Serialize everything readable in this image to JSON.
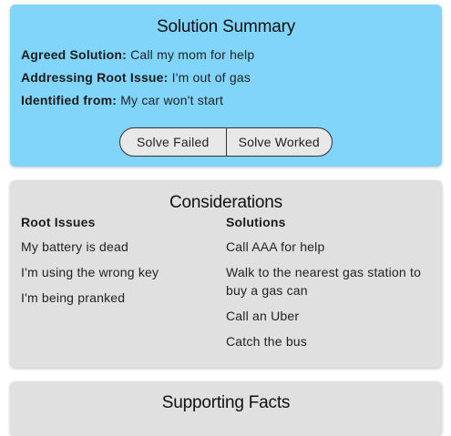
{
  "summary": {
    "title": "Solution Summary",
    "agreed_label": "Agreed Solution:",
    "agreed_value": "Call my mom for help",
    "root_label": "Addressing Root Issue:",
    "root_value": "I'm out of gas",
    "identified_label": "Identified from:",
    "identified_value": "My car won't start",
    "buttons": {
      "failed": "Solve Failed",
      "worked": "Solve Worked"
    },
    "bg_color": "#81d4fa"
  },
  "considerations": {
    "title": "Considerations",
    "root_issues": {
      "heading": "Root Issues",
      "items": [
        "My battery is dead",
        "I'm using the wrong key",
        "I'm being pranked"
      ]
    },
    "solutions": {
      "heading": "Solutions",
      "items": [
        "Call AAA for help",
        "Walk to the nearest gas station to buy a gas can",
        "Call an Uber",
        "Catch the bus"
      ]
    },
    "bg_color": "#e0e0e0"
  },
  "facts": {
    "title": "Supporting Facts"
  }
}
